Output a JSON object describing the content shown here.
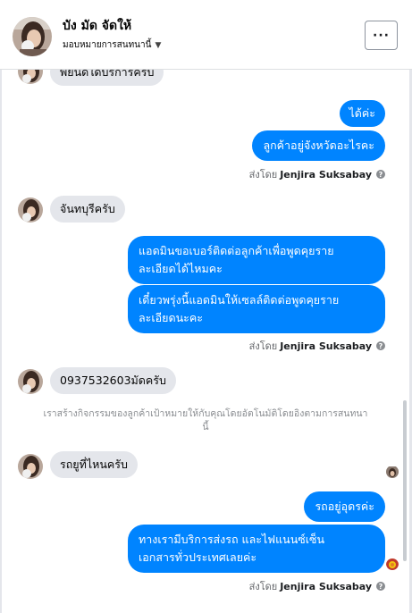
{
  "header": {
    "name": "บัง มัด จัดให้",
    "subtitle": "มอบหมายการสนทนานี้",
    "more_label": "···"
  },
  "messages": {
    "cutoff_incoming": "พยนดใดบรการครบ",
    "out1": "ได้ค่ะ",
    "out2": "ลูกค้าอยู่จังหวัดอะไรคะ",
    "sent_by_prefix": "ส่งโดย",
    "sent_by_name": "Jenjira Suksabay",
    "in1": "จันทบุรีครับ",
    "out3_line1": "แอดมินขอเบอร์ติดต่อลูกค้าเพื่อพูดคุยราย",
    "out3_line2": "ละเอียดได้ไหมคะ",
    "out4_line1": "เดี๋ยวพรุ่งนี้แอดมินให้เซลล์ติดต่อพูดคุยราย",
    "out4_line2": "ละเอียดนะคะ",
    "in2": "0937532603มัดครับ",
    "system_note_line1": "เราสร้างกิจกรรมของลูกค้าเป้าหมายให้กับคุณโดยอัตโนมัติโดยอิงตามการสนทนา",
    "system_note_line2": "นี้",
    "in3": "รถยูที่ไหนครับ",
    "out5": "รถอยู่อุดรค่ะ",
    "out6_line1": "ทางเรามีบริการส่งรถ และไฟแนนซ์เซ็น",
    "out6_line2": "เอกสารทั่วประเทศเลยค่ะ"
  },
  "colors": {
    "outgoing_bubble": "#0084ff",
    "incoming_bubble": "#e4e6eb",
    "meta_text": "#65676b"
  }
}
